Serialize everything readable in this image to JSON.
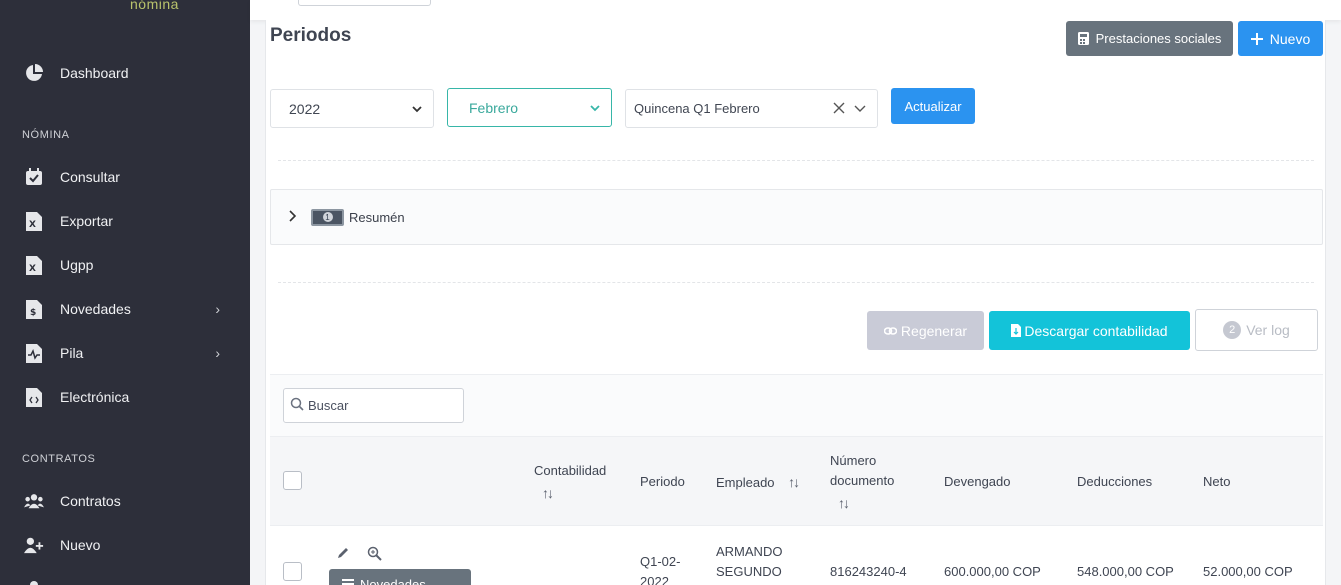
{
  "sidebar": {
    "brand_sub": "nómina",
    "items": [
      {
        "label": "Dashboard"
      },
      {
        "label": "Consultar"
      },
      {
        "label": "Exportar"
      },
      {
        "label": "Ugpp"
      },
      {
        "label": "Novedades"
      },
      {
        "label": "Pila"
      },
      {
        "label": "Electrónica"
      },
      {
        "label": "Contratos"
      },
      {
        "label": "Nuevo"
      }
    ],
    "sections": {
      "nomina": "NÓMINA",
      "contratos": "CONTRATOS"
    }
  },
  "header": {
    "title": "Periodos",
    "prestaciones_label": "Prestaciones sociales",
    "nuevo_label": "Nuevo"
  },
  "filters": {
    "year": "2022",
    "month": "Febrero",
    "period": "Quincena Q1 Febrero",
    "actualizar_label": "Actualizar"
  },
  "resumen": {
    "label": "Resumén",
    "badge": "1"
  },
  "actions": {
    "regenerar_label": "Regenerar",
    "descargar_label": "Descargar contabilidad",
    "verlog_label": "Ver log",
    "verlog_badge": "2"
  },
  "search": {
    "placeholder": "Buscar"
  },
  "table": {
    "headers": {
      "contabilidad": "Contabilidad",
      "periodo": "Periodo",
      "empleado": "Empleado",
      "numero_documento_1": "Número",
      "numero_documento_2": "documento",
      "devengado": "Devengado",
      "deducciones": "Deducciones",
      "neto": "Neto"
    },
    "rows": [
      {
        "periodo_1": "Q1-02-",
        "periodo_2": "2022",
        "empleado_1": "ARMANDO",
        "empleado_2": "SEGUNDO",
        "documento": "816243240-4",
        "devengado": "600.000,00 COP",
        "deducciones": "548.000,00 COP",
        "neto": "52.000,00 COP",
        "novedades_label": "Novedades"
      }
    ]
  },
  "colors": {
    "sidebar": "#2d2f3a",
    "primary": "#2b93f0",
    "secondary": "#68737d",
    "teal": "#37b6a8",
    "cyan": "#13c3d9"
  }
}
